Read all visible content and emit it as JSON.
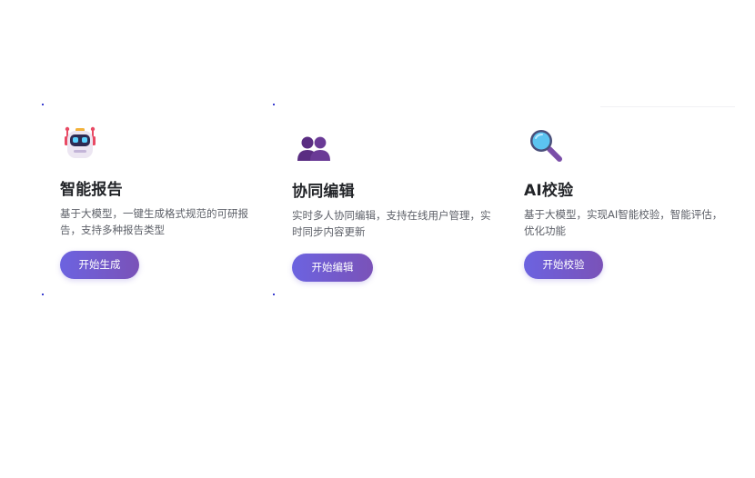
{
  "features": [
    {
      "icon": "robot-icon",
      "title": "智能报告",
      "description": "基于大模型，一键生成格式规范的可研报告，支持多种报告类型",
      "button_label": "开始生成"
    },
    {
      "icon": "users-icon",
      "title": "协同编辑",
      "description": "实时多人协同编辑，支持在线用户管理，实时同步内容更新",
      "button_label": "开始编辑"
    },
    {
      "icon": "magnifier-icon",
      "title": "AI校验",
      "description": "基于大模型，实现AI智能校验，智能评估，优化功能",
      "button_label": "开始校验"
    }
  ],
  "colors": {
    "button_gradient_start": "#6c63e0",
    "button_gradient_end": "#7a52b8",
    "title": "#222428",
    "description": "#5d6068"
  }
}
